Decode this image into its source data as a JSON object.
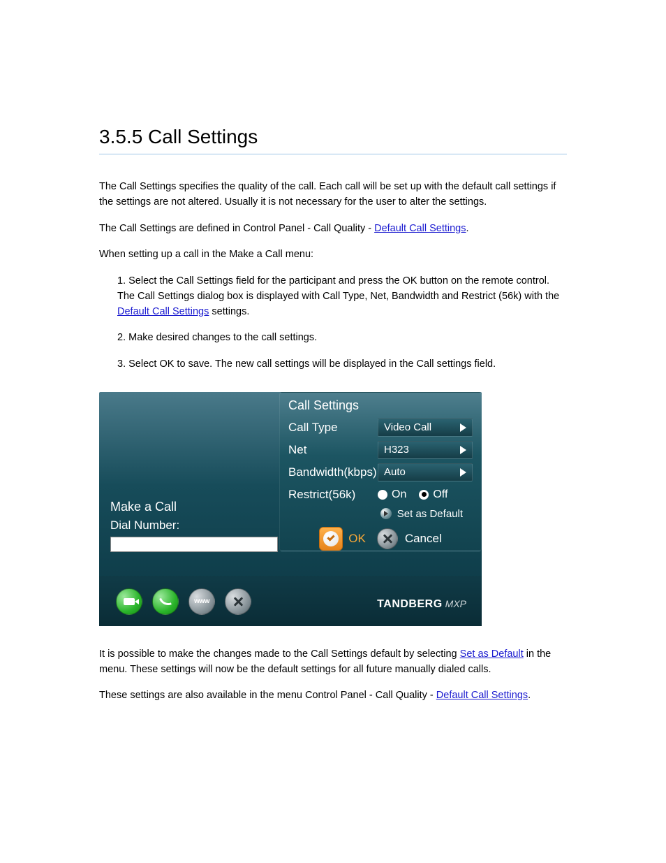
{
  "section": {
    "title": "3.5.5 Call Settings",
    "para1_a": "The Call Settings specifies the quality of the call. Each call will be set up with the default call settings if the settings are not altered. Usually it is not necessary for the user to alter the settings.",
    "para2_a": "The Call Settings are defined in Control Panel - Call Quality - ",
    "link_default_call_settings": "Default Call Settings",
    "para2_b": ".",
    "para3_a": "When setting up a call in the Make a Call menu:",
    "step1_a": "1. Select the Call Settings field for the participant and press the OK button on the remote control. The Call Settings dialog box is displayed with Call Type, Net, Bandwidth and Restrict (56k) with the ",
    "link_default_call_settings_2": "Default Call Settings",
    "step1_b": " settings.",
    "step2": "2. Make desired changes to the call settings.",
    "step3": "3. Select OK to save. The new call settings will be displayed in the Call settings field.",
    "para4_a": "It is possible to make the changes made to the Call Settings default by selecting Set as Default in the menu. These settings will now be the default settings for all future manually dialed calls.",
    "para5_a": "These settings are also available in the menu Control Panel - Call Quality - ",
    "link_default_call_settings_3": "Default Call Settings",
    "para5_b": "."
  },
  "ui": {
    "makeCall": {
      "title": "Make a Call",
      "dialLabel": "Dial Number:",
      "dialValue": ""
    },
    "callSettings": {
      "title": "Call Settings",
      "rows": {
        "callType": {
          "label": "Call Type",
          "value": "Video Call"
        },
        "net": {
          "label": "Net",
          "value": "H323"
        },
        "bandwidth": {
          "label": "Bandwidth(kbps)",
          "value": "Auto"
        },
        "restrict": {
          "label": "Restrict(56k)",
          "on": "On",
          "off": "Off",
          "selected": "Off"
        }
      },
      "setDefault": "Set as Default",
      "ok": "OK",
      "cancel": "Cancel"
    },
    "logo": {
      "brand": "TANDBERG",
      "suffix": "MXP"
    },
    "toolbar": {
      "www": "www"
    }
  }
}
